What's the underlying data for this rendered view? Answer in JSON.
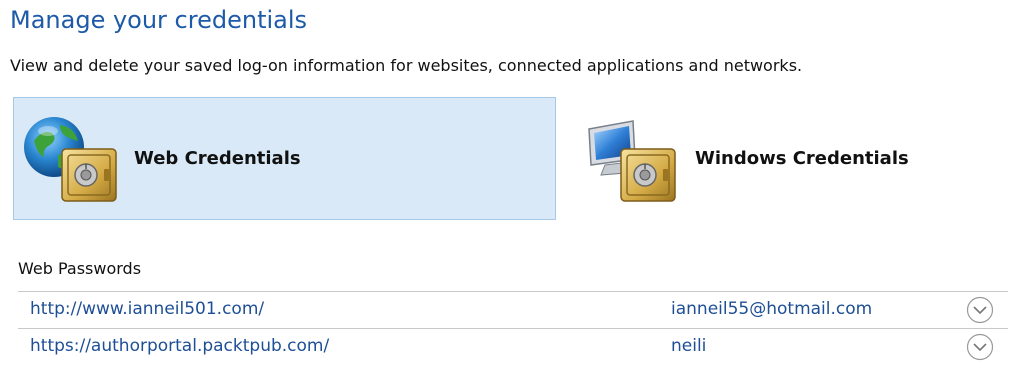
{
  "header": {
    "title": "Manage your credentials",
    "description": "View and delete your saved log-on information for websites, connected applications and networks."
  },
  "credential_types": [
    {
      "label": "Web Credentials",
      "icon": "globe-vault-icon",
      "selected": true
    },
    {
      "label": "Windows Credentials",
      "icon": "computer-vault-icon",
      "selected": false
    }
  ],
  "web_passwords": {
    "section_label": "Web Passwords",
    "rows": [
      {
        "url": "http://www.ianneil501.com/",
        "user": "ianneil55@hotmail.com",
        "action_icon": "chevron-down-icon"
      },
      {
        "url": "https://authorportal.packtpub.com/",
        "user": "neili",
        "action_icon": "chevron-down-icon"
      }
    ]
  },
  "colors": {
    "accent": "#1e5aa8",
    "selected_bg": "#d9e9f7",
    "selected_border": "#a7c8e6",
    "link": "#1e4f96"
  }
}
